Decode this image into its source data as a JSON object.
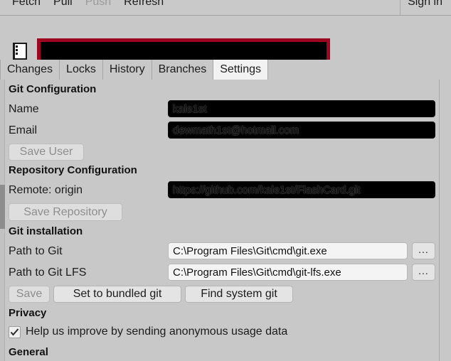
{
  "toolbar": {
    "buttons": [
      {
        "label": "Fetch",
        "enabled": true
      },
      {
        "label": "Pull",
        "enabled": true
      },
      {
        "label": "Push",
        "enabled": false
      },
      {
        "label": "Refresh",
        "enabled": true
      }
    ],
    "sign_in_label": "Sign in"
  },
  "repo_header": {
    "icon": "repository-book-icon",
    "name_redacted": true,
    "redaction_border_color": "#9e0521",
    "redaction_fill_color": "#000000"
  },
  "tabs": [
    {
      "label": "Changes",
      "active": false
    },
    {
      "label": "Locks",
      "active": false
    },
    {
      "label": "History",
      "active": false
    },
    {
      "label": "Branches",
      "active": false
    },
    {
      "label": "Settings",
      "active": true
    }
  ],
  "settings": {
    "git_configuration": {
      "title": "Git Configuration",
      "name_label": "Name",
      "name_value": "kale1st",
      "email_label": "Email",
      "email_value": "dewmath1st@hotmail.com",
      "save_user_label": "Save User",
      "save_user_enabled": false
    },
    "repository_configuration": {
      "title": "Repository Configuration",
      "remote_label": "Remote: origin",
      "remote_value": "https://github.com/kale1st/FlashCard.git",
      "save_repository_label": "Save Repository",
      "save_repository_enabled": false
    },
    "git_installation": {
      "title": "Git installation",
      "path_to_git_label": "Path to Git",
      "path_to_git_value": "C:\\Program Files\\Git\\cmd\\git.exe",
      "path_to_git_browse_label": "...",
      "path_to_git_lfs_label": "Path to Git LFS",
      "path_to_git_lfs_value": "C:\\Program Files\\Git\\cmd\\git-lfs.exe",
      "path_to_git_lfs_browse_label": "...",
      "save_label": "Save",
      "save_enabled": false,
      "set_bundled_label": "Set to bundled git",
      "find_system_label": "Find system git"
    },
    "privacy": {
      "title": "Privacy",
      "usage_data_label": "Help us improve by sending anonymous usage data",
      "usage_data_checked": true
    },
    "general": {
      "title": "General"
    }
  },
  "colors": {
    "window_background": "#c8c8c8",
    "active_tab_background": "#f2f2f2",
    "redaction_red": "#9e0521",
    "input_background": "#f4f4f4",
    "disabled_text": "#8d8d8d"
  }
}
